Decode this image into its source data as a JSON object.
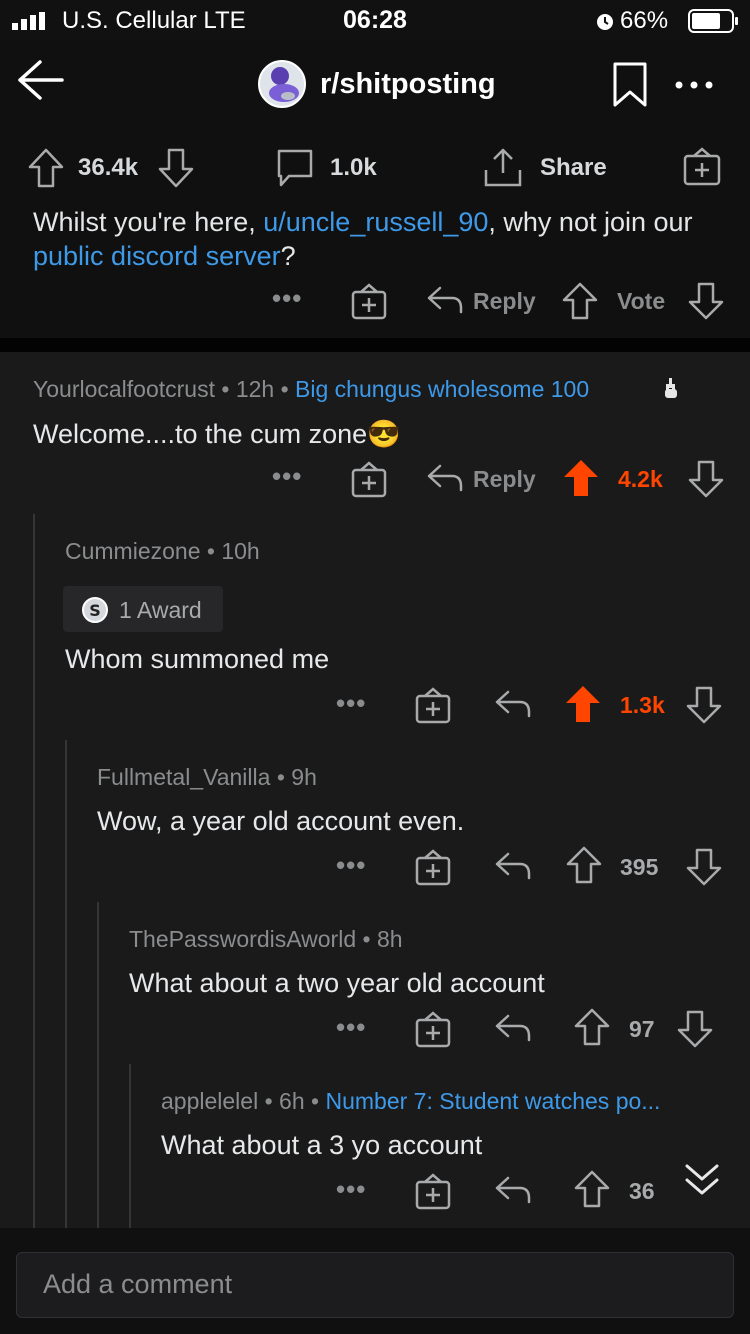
{
  "status": {
    "carrier": "U.S. Cellular  LTE",
    "time": "06:28",
    "battery": "66%"
  },
  "header": {
    "subreddit": "r/shitposting"
  },
  "post_actions": {
    "upvotes": "36.4k",
    "comments": "1.0k",
    "share": "Share"
  },
  "mod_comment": {
    "text_before": "Whilst you're here, ",
    "user_link": "u/uncle_russell_90",
    "text_middle": ", why not join our ",
    "discord_link": "public discord server",
    "text_after": "?",
    "reply": "Reply",
    "vote": "Vote"
  },
  "comments": [
    {
      "author": "Yourlocalfootcrust",
      "age": "12h",
      "flair": "Big chungus wholesome 100",
      "body": "Welcome....to the cum zone",
      "emoji": "😎",
      "reply": "Reply",
      "score": "4.2k"
    },
    {
      "author": "Cummiezone",
      "age": "10h",
      "award": "1 Award",
      "body": "Whom summoned me",
      "score": "1.3k"
    },
    {
      "author": "Fullmetal_Vanilla",
      "age": "9h",
      "body": "Wow, a year old account even.",
      "score": "395"
    },
    {
      "author": "ThePasswordisAworld",
      "age": "8h",
      "body": "What about a two year old account",
      "score": "97"
    },
    {
      "author": "applelelel",
      "age": "6h",
      "flair": "Number 7: Student watches po...",
      "body": "What about a 3 yo account",
      "score": "36"
    }
  ],
  "composer": {
    "placeholder": "Add a comment"
  },
  "colors": {
    "upvote": "#ff4500",
    "link": "#3e9ae8",
    "background": "#101010",
    "comment_bg": "#1a1a1b"
  }
}
